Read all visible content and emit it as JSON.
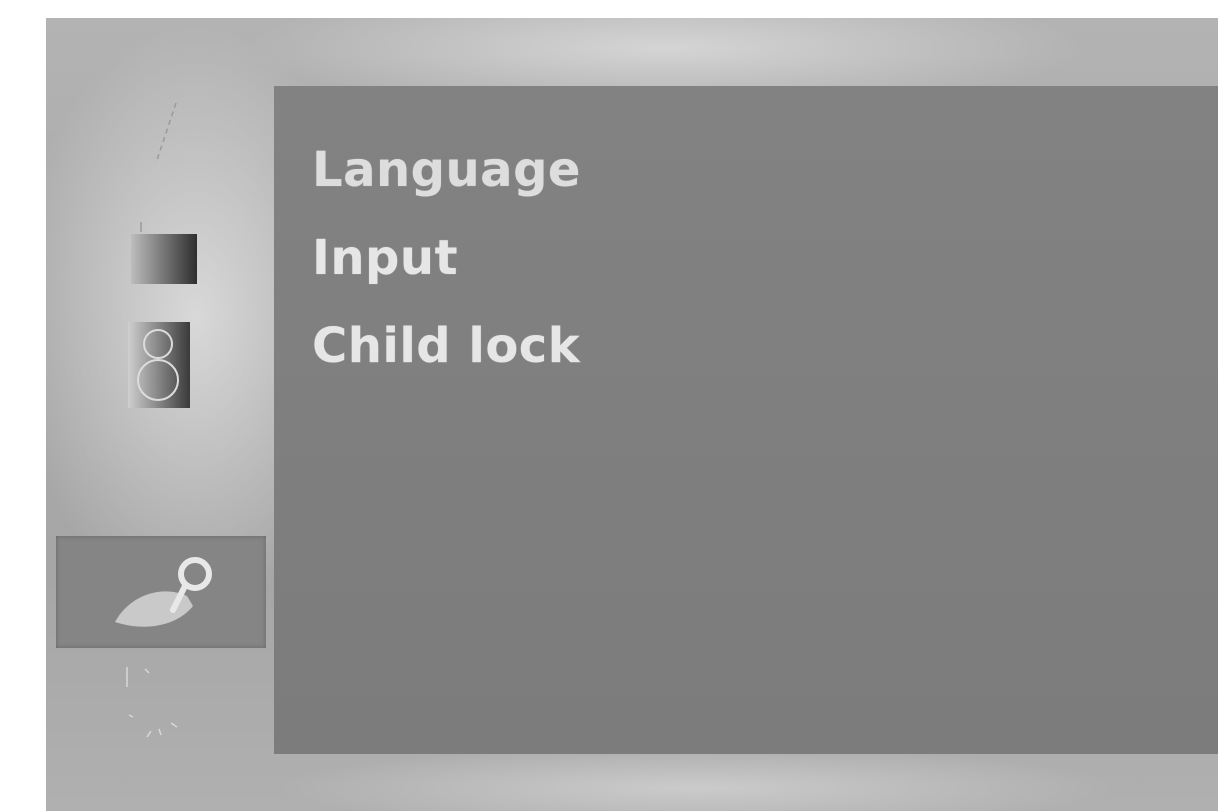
{
  "sidebar": {
    "icons": [
      {
        "name": "picture-icon",
        "selected": false
      },
      {
        "name": "tv-screen-icon",
        "selected": false
      },
      {
        "name": "speaker-icon",
        "selected": false
      },
      {
        "name": "time-icon",
        "selected": false
      },
      {
        "name": "option-icon",
        "selected": true
      },
      {
        "name": "screen-icon",
        "selected": false
      }
    ]
  },
  "menu": {
    "items": [
      {
        "label": "Language"
      },
      {
        "label": "Input"
      },
      {
        "label": "Child lock"
      }
    ]
  }
}
